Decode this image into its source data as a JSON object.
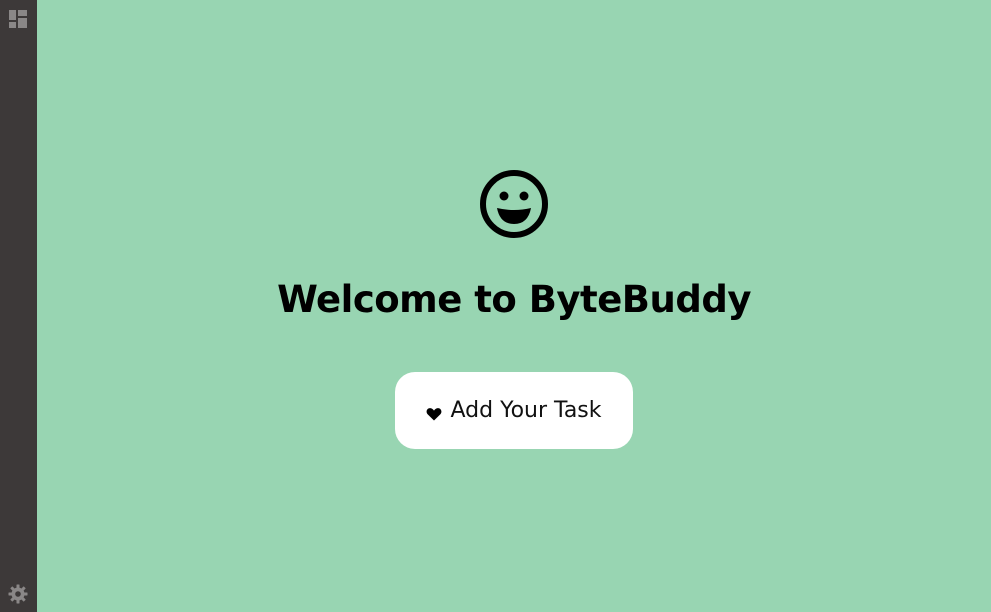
{
  "app": {
    "title": "Welcome to ByteBuddy"
  },
  "sidebar": {
    "top_icon": "dashboard-icon",
    "bottom_icon": "gear-icon"
  },
  "main": {
    "hero_icon": "smiley-icon",
    "heading": "Welcome to ByteBuddy",
    "primary_button": {
      "icon": "heart-icon",
      "label": "Add Your Task"
    }
  },
  "colors": {
    "sidebar_bg": "#3d3939",
    "main_bg": "#98d5b2",
    "button_bg": "#ffffff",
    "text": "#000000",
    "icon_muted": "#8a8787"
  }
}
